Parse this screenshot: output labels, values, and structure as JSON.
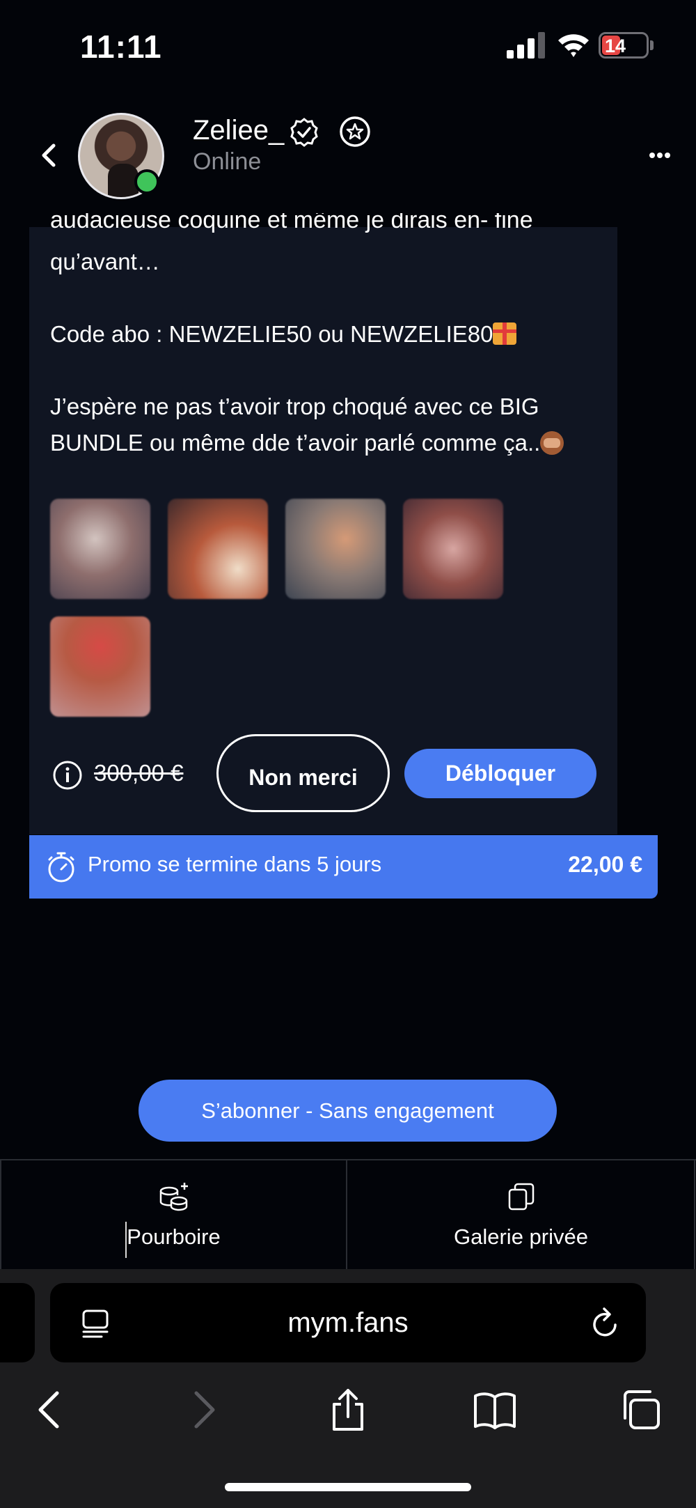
{
  "status_bar": {
    "time": "11:11",
    "battery": "14"
  },
  "profile": {
    "username": "Zeliee_",
    "status": "Online"
  },
  "message": {
    "cut_line": "audacieuse coquine et même je dirais en- fine",
    "line1": "qu’avant…",
    "line2": "Code abo : NEWZELIE50 ou NEWZELIE80",
    "line3a": "J’espère ne pas t’avoir trop choqué avec ce BIG",
    "line3b": "BUNDLE ou même dde t’avoir parlé comme ça.."
  },
  "offer": {
    "old_price": "300,00 €",
    "no_thanks_label": "Non merci",
    "unlock_label": "Débloquer",
    "promo_text": "Promo se termine dans 5 jours",
    "promo_price": "22,00 €"
  },
  "subscribe_label": "S’abonner - Sans engagement",
  "tabs": {
    "tip_label": "Pourboire",
    "gallery_label": "Galerie privée"
  },
  "browser": {
    "url": "mym.fans"
  },
  "icons": {
    "back": "chevron-left-icon",
    "verified": "verified-badge-icon",
    "star": "star-badge-icon",
    "more": "more-dots-icon",
    "info": "info-icon",
    "timer": "stopwatch-icon",
    "tip": "coins-plus-icon",
    "gallery": "copy-squares-icon",
    "page": "page-settings-icon",
    "reload": "reload-icon",
    "share": "share-icon",
    "bookmarks": "book-icon",
    "tabs": "tabs-icon"
  },
  "colors": {
    "accent": "#4a7cf2",
    "online": "#3fc45a",
    "card": "#101522"
  }
}
